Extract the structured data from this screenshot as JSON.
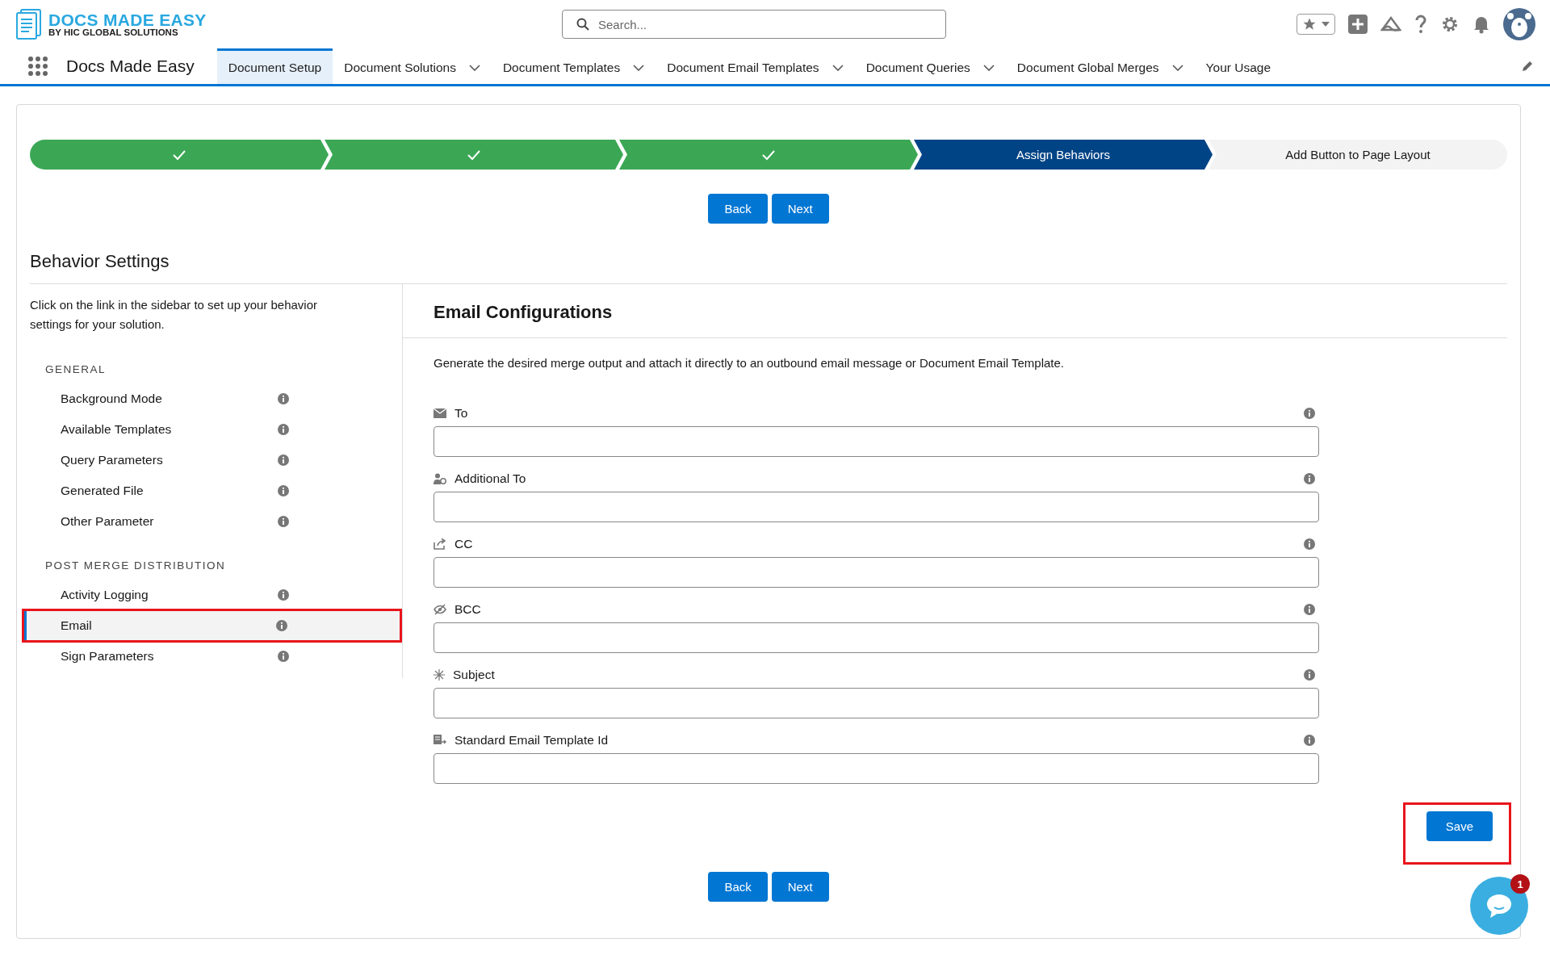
{
  "header": {
    "logo_title": "DOCS MADE EASY",
    "logo_subtitle": "BY HIC GLOBAL SOLUTIONS",
    "search": {
      "placeholder": "Search..."
    }
  },
  "nav": {
    "app_name": "Docs Made Easy",
    "tabs": [
      {
        "label": "Document Setup",
        "selected": true,
        "has_menu": false
      },
      {
        "label": "Document Solutions",
        "selected": false,
        "has_menu": true
      },
      {
        "label": "Document Templates",
        "selected": false,
        "has_menu": true
      },
      {
        "label": "Document Email Templates",
        "selected": false,
        "has_menu": true
      },
      {
        "label": "Document Queries",
        "selected": false,
        "has_menu": true
      },
      {
        "label": "Document Global Merges",
        "selected": false,
        "has_menu": true
      },
      {
        "label": "Your Usage",
        "selected": false,
        "has_menu": false
      }
    ]
  },
  "progress": {
    "steps": [
      {
        "done": true,
        "selected": false
      },
      {
        "done": true,
        "selected": false
      },
      {
        "done": true,
        "selected": false
      },
      {
        "done": false,
        "selected": true,
        "label": "Assign Behaviors"
      },
      {
        "done": false,
        "selected": false,
        "label": "Add Button to Page Layout"
      }
    ]
  },
  "top_buttons": [
    "Back",
    "Next"
  ],
  "section_title": "Behavior Settings",
  "sidebar": {
    "intro": "Click on the link in the sidebar to set up your behavior settings for your solution.",
    "groups": [
      {
        "heading": "GENERAL",
        "items": [
          {
            "label": "Background Mode",
            "selected": false,
            "highlighted": false
          },
          {
            "label": "Available Templates",
            "selected": false,
            "highlighted": false
          },
          {
            "label": "Query Parameters",
            "selected": false,
            "highlighted": false
          },
          {
            "label": "Generated File",
            "selected": false,
            "highlighted": false
          },
          {
            "label": "Other Parameter",
            "selected": false,
            "highlighted": false
          }
        ]
      },
      {
        "heading": "POST MERGE DISTRIBUTION",
        "items": [
          {
            "label": "Activity Logging",
            "selected": false,
            "highlighted": false
          },
          {
            "label": "Email",
            "selected": true,
            "highlighted": true
          },
          {
            "label": "Sign Parameters",
            "selected": false,
            "highlighted": false
          }
        ]
      }
    ]
  },
  "panel": {
    "title": "Email Configurations",
    "description": "Generate the desired merge output and attach it directly to an outbound email message or Document Email Template.",
    "fields": [
      {
        "label": "To"
      },
      {
        "label": "Additional To"
      },
      {
        "label": "CC"
      },
      {
        "label": "BCC"
      },
      {
        "label": "Subject"
      },
      {
        "label": "Standard Email Template Id"
      }
    ]
  },
  "save_button": {
    "label": "Save",
    "highlighted": true
  },
  "bottom_buttons": [
    "Back",
    "Next"
  ],
  "chat": {
    "badge": "1"
  }
}
